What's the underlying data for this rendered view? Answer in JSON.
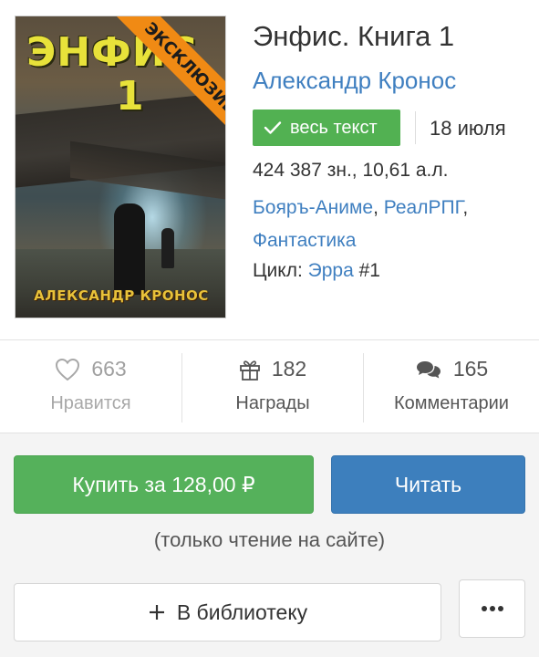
{
  "book": {
    "cover": {
      "title_text": "ЭНФИС",
      "title_number": "1",
      "ribbon": "ЭКСКЛЮЗИВ",
      "author_text": "АЛЕКСАНДР КРОНОС"
    },
    "title": "Энфис. Книга 1",
    "author": "Александр Кронос",
    "badge_label": "весь текст",
    "date": "18 июля",
    "stats": "424 387 зн., 10,61 а.л.",
    "genres": [
      "Бояръ-Аниме",
      "РеалРПГ",
      "Фантастика"
    ],
    "genre_separator": ",",
    "cycle_label": "Цикл:",
    "cycle_name": "Эрра",
    "cycle_number": "#1"
  },
  "stats_row": {
    "likes": {
      "count": "663",
      "label": "Нравится",
      "icon": "heart-icon"
    },
    "awards": {
      "count": "182",
      "label": "Награды",
      "icon": "gift-icon"
    },
    "comments": {
      "count": "165",
      "label": "Комментарии",
      "icon": "comments-icon"
    }
  },
  "actions": {
    "buy_label": "Купить за 128,00 ₽",
    "read_label": "Читать",
    "note": "(только чтение на сайте)",
    "library_label": "В библиотеку",
    "more_icon": "more-dots-icon"
  },
  "colors": {
    "link": "#3f7fc0",
    "badge_green": "#52b152",
    "buy_green": "#55b15b",
    "read_blue": "#3d7fbd",
    "muted": "#a0a0a0",
    "ribbon_orange": "#f08a14"
  }
}
